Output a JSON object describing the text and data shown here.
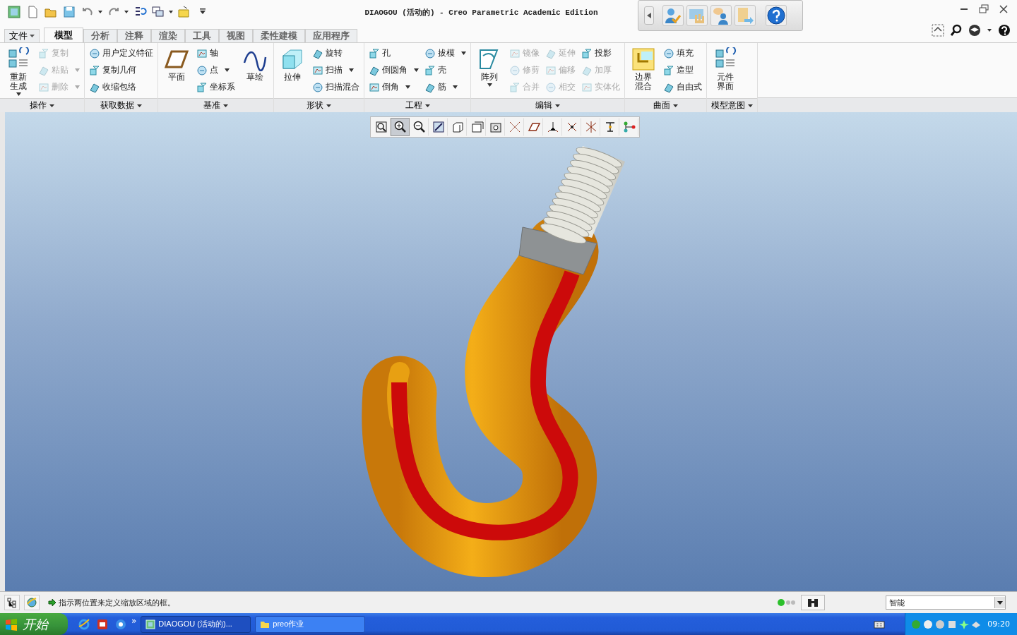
{
  "window": {
    "title": "DIAOGOU (活动的) - Creo Parametric Academic Edition"
  },
  "quick_access": [
    {
      "kind": "app",
      "dropdown": false
    },
    {
      "kind": "new",
      "dropdown": false
    },
    {
      "kind": "open",
      "dropdown": false
    },
    {
      "kind": "save",
      "dropdown": false
    },
    {
      "kind": "undo",
      "dropdown": true
    },
    {
      "kind": "redo",
      "dropdown": true
    },
    {
      "kind": "regen",
      "dropdown": false
    },
    {
      "kind": "windows",
      "dropdown": true
    },
    {
      "kind": "folder",
      "dropdown": false
    },
    {
      "kind": "more",
      "dropdown": false
    }
  ],
  "file_menu": {
    "label": "文件"
  },
  "tabs": [
    {
      "label": "模型",
      "selected": true
    },
    {
      "label": "分析",
      "selected": false
    },
    {
      "label": "注释",
      "selected": false
    },
    {
      "label": "渲染",
      "selected": false
    },
    {
      "label": "工具",
      "selected": false
    },
    {
      "label": "视图",
      "selected": false
    },
    {
      "label": "柔性建模",
      "selected": false
    },
    {
      "label": "应用程序",
      "selected": false
    }
  ],
  "ribbon": {
    "groups": [
      {
        "label": "操作",
        "columns": [
          {
            "kind": "large",
            "items": [
              {
                "label": "重新生成",
                "dropdown": true,
                "disabled": false
              }
            ]
          },
          {
            "kind": "stack",
            "items": [
              {
                "label": "复制",
                "dropdown": false,
                "disabled": true
              },
              {
                "label": "粘贴",
                "dropdown": true,
                "disabled": true
              },
              {
                "label": "删除",
                "dropdown": true,
                "disabled": true
              }
            ]
          }
        ]
      },
      {
        "label": "获取数据",
        "columns": [
          {
            "kind": "stack",
            "items": [
              {
                "label": "用户定义特征",
                "dropdown": false,
                "disabled": false
              },
              {
                "label": "复制几何",
                "dropdown": false,
                "disabled": false
              },
              {
                "label": "收缩包络",
                "dropdown": false,
                "disabled": false
              }
            ]
          }
        ]
      },
      {
        "label": "基准",
        "columns": [
          {
            "kind": "large",
            "items": [
              {
                "label": "平面",
                "dropdown": false,
                "disabled": false
              }
            ]
          },
          {
            "kind": "stack",
            "items": [
              {
                "label": "轴",
                "dropdown": false,
                "disabled": false
              },
              {
                "label": "点",
                "dropdown": true,
                "disabled": false
              },
              {
                "label": "坐标系",
                "dropdown": false,
                "disabled": false
              }
            ]
          },
          {
            "kind": "large",
            "items": [
              {
                "label": "草绘",
                "dropdown": false,
                "disabled": false
              }
            ]
          }
        ]
      },
      {
        "label": "形状",
        "columns": [
          {
            "kind": "large",
            "items": [
              {
                "label": "拉伸",
                "dropdown": false,
                "disabled": false
              }
            ]
          },
          {
            "kind": "stack",
            "items": [
              {
                "label": "旋转",
                "dropdown": false,
                "disabled": false
              },
              {
                "label": "扫描",
                "dropdown": true,
                "disabled": false
              },
              {
                "label": "扫描混合",
                "dropdown": false,
                "disabled": false
              }
            ]
          }
        ]
      },
      {
        "label": "工程",
        "columns": [
          {
            "kind": "stack",
            "items": [
              {
                "label": "孔",
                "dropdown": false,
                "disabled": false
              },
              {
                "label": "倒圆角",
                "dropdown": true,
                "disabled": false
              },
              {
                "label": "倒角",
                "dropdown": true,
                "disabled": false
              }
            ]
          },
          {
            "kind": "stack",
            "items": [
              {
                "label": "拔模",
                "dropdown": true,
                "disabled": false
              },
              {
                "label": "壳",
                "dropdown": false,
                "disabled": false
              },
              {
                "label": "筋",
                "dropdown": true,
                "disabled": false
              }
            ]
          }
        ]
      },
      {
        "label": "编辑",
        "columns": [
          {
            "kind": "large",
            "items": [
              {
                "label": "阵列",
                "dropdown": true,
                "disabled": false
              }
            ]
          },
          {
            "kind": "stack",
            "items": [
              {
                "label": "镜像",
                "dropdown": false,
                "disabled": true
              },
              {
                "label": "修剪",
                "dropdown": false,
                "disabled": true
              },
              {
                "label": "合并",
                "dropdown": false,
                "disabled": true
              }
            ]
          },
          {
            "kind": "stack",
            "items": [
              {
                "label": "延伸",
                "dropdown": false,
                "disabled": true
              },
              {
                "label": "偏移",
                "dropdown": false,
                "disabled": true
              },
              {
                "label": "相交",
                "dropdown": false,
                "disabled": true
              }
            ]
          },
          {
            "kind": "stack",
            "items": [
              {
                "label": "投影",
                "dropdown": false,
                "disabled": false
              },
              {
                "label": "加厚",
                "dropdown": false,
                "disabled": true
              },
              {
                "label": "实体化",
                "dropdown": false,
                "disabled": true
              }
            ]
          }
        ]
      },
      {
        "label": "曲面",
        "columns": [
          {
            "kind": "large",
            "items": [
              {
                "label": "边界混合",
                "dropdown": false,
                "disabled": false
              }
            ]
          },
          {
            "kind": "stack",
            "items": [
              {
                "label": "填充",
                "dropdown": false,
                "disabled": false
              },
              {
                "label": "造型",
                "dropdown": false,
                "disabled": false
              },
              {
                "label": "自由式",
                "dropdown": false,
                "disabled": false
              }
            ]
          }
        ]
      },
      {
        "label": "模型意图",
        "columns": [
          {
            "kind": "large",
            "items": [
              {
                "label": "元件界面",
                "dropdown": false,
                "disabled": false
              }
            ]
          }
        ]
      }
    ]
  },
  "view_toolbar": [
    {
      "kind": "refit",
      "selected": false
    },
    {
      "kind": "zoomin",
      "selected": true
    },
    {
      "kind": "zoomout",
      "selected": false
    },
    {
      "kind": "repaint",
      "selected": false
    },
    {
      "kind": "style",
      "selected": false
    },
    {
      "kind": "views",
      "selected": false
    },
    {
      "kind": "manager",
      "selected": false
    },
    {
      "kind": "axes",
      "selected": false
    },
    {
      "kind": "planes",
      "selected": false
    },
    {
      "kind": "points",
      "selected": false
    },
    {
      "kind": "csys",
      "selected": false
    },
    {
      "kind": "annotations",
      "selected": false
    },
    {
      "kind": "spin",
      "selected": false
    },
    {
      "kind": "tree",
      "selected": false
    }
  ],
  "status_bar": {
    "message": "指示两位置来定义缩放区域的框。",
    "filter": "智能"
  },
  "taskbar": {
    "start": "开始",
    "more": "»",
    "tasks": [
      {
        "label": "DIAOGOU (活动的)...",
        "selected": true
      },
      {
        "label": "preo作业",
        "selected": false
      }
    ],
    "clock": "09:20"
  }
}
